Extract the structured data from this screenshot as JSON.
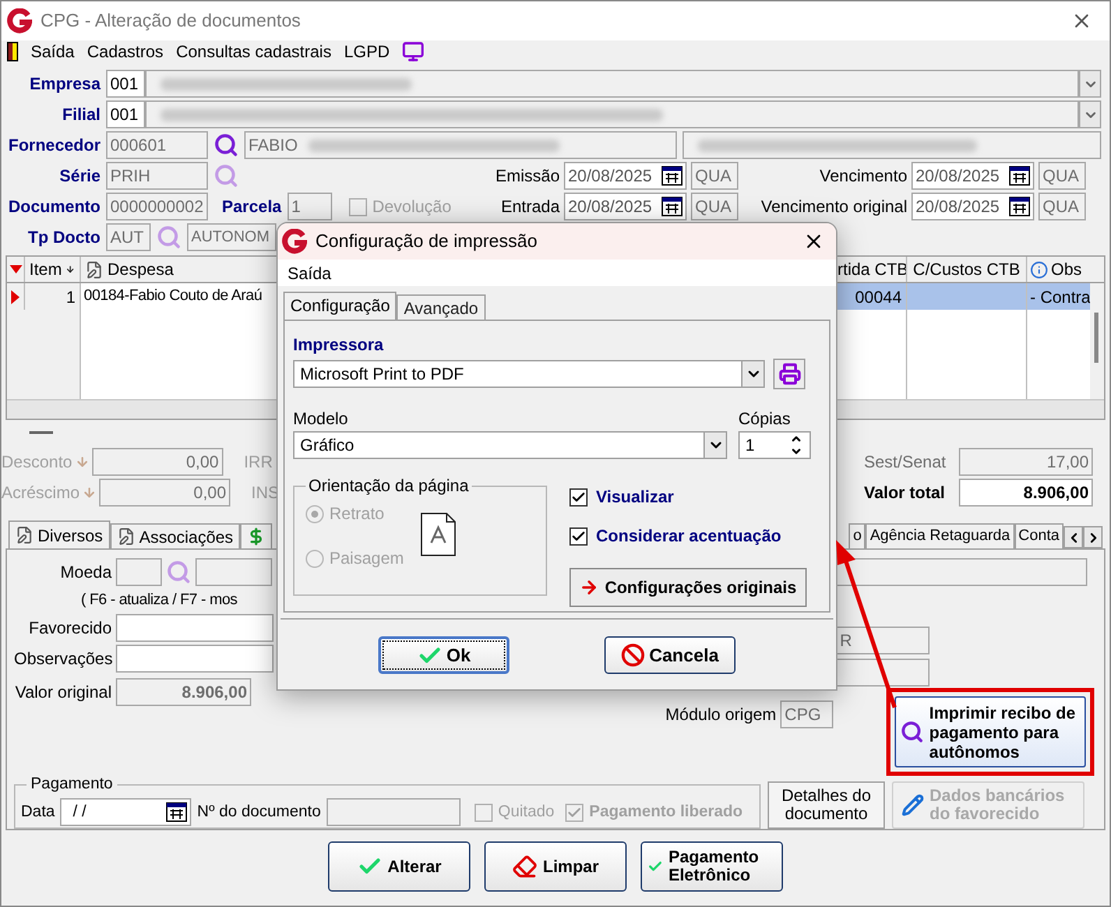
{
  "window": {
    "title": "CPG - Alteração de documentos"
  },
  "menu": [
    "Saída",
    "Cadastros",
    "Consultas cadastrais",
    "LGPD"
  ],
  "header": {
    "empresa": {
      "label": "Empresa",
      "code": "001"
    },
    "filial": {
      "label": "Filial",
      "code": "001"
    },
    "fornecedor": {
      "label": "Fornecedor",
      "code": "000601",
      "name": "FABIO"
    },
    "serie": {
      "label": "Série",
      "value": "PRIH"
    },
    "documento": {
      "label": "Documento",
      "value": "0000000002"
    },
    "parcela": {
      "label": "Parcela",
      "value": "1"
    },
    "devolucao": {
      "label": "Devolução",
      "checked": false,
      "disabled": true
    },
    "tp_docto": {
      "label": "Tp Docto",
      "code": "AUT",
      "name": "AUTONOM"
    },
    "dates": [
      {
        "label": "Emissão",
        "date": "20/08/2025",
        "weekday": "QUA"
      },
      {
        "label": "Vencimento",
        "date": "20/08/2025",
        "weekday": "QUA"
      },
      {
        "label": "Entrada",
        "date": "20/08/2025",
        "weekday": "QUA"
      },
      {
        "label": "Vencimento original",
        "date": "20/08/2025",
        "weekday": "QUA"
      }
    ]
  },
  "grid": {
    "columns": [
      "Item",
      "Despesa",
      "rtida CTB",
      "C/Custos CTB",
      "Obs"
    ],
    "rows": [
      {
        "item": "1",
        "despesa": "00184-Fabio Couto de Araú",
        "partida": "00044",
        "obs": "- Contra",
        "selected": true
      }
    ]
  },
  "totals": {
    "left": [
      {
        "label": "Desconto",
        "value": "0,00",
        "tax": "IRR"
      },
      {
        "label": "Acréscimo",
        "value": "0,00",
        "tax": "INS"
      }
    ],
    "sest_senat": {
      "label": "Sest/Senat",
      "value": "17,00"
    },
    "valor_total": {
      "label": "Valor total",
      "value": "8.906,00"
    }
  },
  "tabs_left": [
    {
      "kind": "text",
      "label": "Diversos",
      "selected": true
    },
    {
      "kind": "text",
      "label": "Associações",
      "selected": false
    },
    {
      "kind": "icon",
      "selected": false
    }
  ],
  "tabs_right": [
    {
      "label": "o",
      "selected": false
    },
    {
      "label": "Agência Retaguarda",
      "selected": false
    },
    {
      "label": "Conta",
      "selected": false
    }
  ],
  "diversos": {
    "moeda": "Moeda",
    "hint": "( F6 - atualiza / F7 - mos",
    "favorecido": "Favorecido",
    "observacoes": "Observações",
    "valor_original": {
      "label": "Valor original",
      "value": "8.906,00"
    },
    "field_r": "R",
    "modulo_origem": {
      "label": "Módulo origem",
      "value": "CPG"
    },
    "print_receipt_button": "Imprimir recibo de pagamento para autônomos",
    "pagamento": {
      "title": "Pagamento",
      "data_label": "Data",
      "data_value": "/ /",
      "doc_label": "Nº do documento",
      "quitado": {
        "label": "Quitado",
        "checked": false,
        "disabled": true
      },
      "liberado": {
        "label": "Pagamento liberado",
        "checked": true,
        "disabled": true
      }
    },
    "details_button": "Detalhes do documento",
    "bank_button": {
      "label": "Dados bancários do favorecido",
      "disabled": true
    }
  },
  "actions": [
    "Alterar",
    "Limpar",
    "Pagamento Eletrônico"
  ],
  "dialog": {
    "title": "Configuração de impressão",
    "menu": "Saída",
    "tabs": [
      {
        "label": "Configuração",
        "selected": true
      },
      {
        "label": "Avançado",
        "selected": false
      }
    ],
    "impressora": {
      "label": "Impressora",
      "value": "Microsoft Print to PDF"
    },
    "modelo": {
      "label": "Modelo",
      "value": "Gráfico"
    },
    "copias": {
      "label": "Cópias",
      "value": "1"
    },
    "orientacao": {
      "title": "Orientação da página",
      "disabled": true,
      "options": [
        {
          "label": "Retrato",
          "selected": true
        },
        {
          "label": "Paisagem",
          "selected": false
        }
      ]
    },
    "checks": [
      {
        "label": "Visualizar",
        "checked": true
      },
      {
        "label": "Considerar acentuação",
        "checked": true
      }
    ],
    "reset_button": "Configurações originais",
    "buttons": [
      {
        "kind": "ok",
        "label": "Ok"
      },
      {
        "kind": "cancel",
        "label": "Cancela"
      }
    ]
  }
}
